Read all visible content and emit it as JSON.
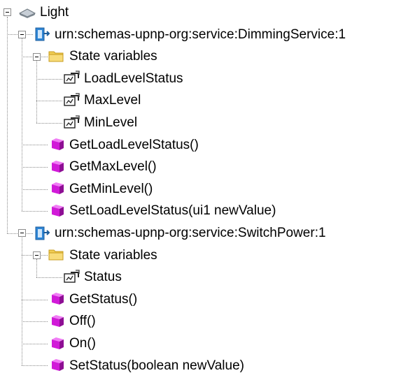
{
  "tree": {
    "root": {
      "label": "Light",
      "icon": "light-device-icon"
    },
    "services": [
      {
        "label": "urn:schemas-upnp-org:service:DimmingService:1",
        "icon": "service-icon",
        "state_folder": {
          "label": "State variables",
          "icon": "folder-icon"
        },
        "state_variables": [
          "LoadLevelStatus",
          "MaxLevel",
          "MinLevel"
        ],
        "actions": [
          "GetLoadLevelStatus()",
          "GetMaxLevel()",
          "GetMinLevel()",
          "SetLoadLevelStatus(ui1 newValue)"
        ]
      },
      {
        "label": "urn:schemas-upnp-org:service:SwitchPower:1",
        "icon": "service-icon",
        "state_folder": {
          "label": "State variables",
          "icon": "folder-icon"
        },
        "state_variables": [
          "Status"
        ],
        "actions": [
          "GetStatus()",
          "Off()",
          "On()",
          "SetStatus(boolean newValue)"
        ]
      }
    ]
  },
  "colors": {
    "action_icon": "#d11ad8",
    "service_icon": "#2f86d6",
    "folder": "#f1cd54",
    "tree_line": "#8a8a8a"
  }
}
